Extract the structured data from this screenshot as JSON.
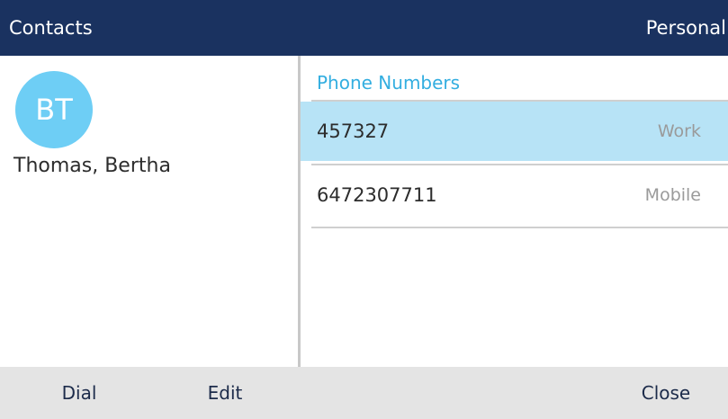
{
  "header": {
    "title": "Contacts",
    "list_name": "Personal"
  },
  "contact": {
    "initials": "BT",
    "name": "Thomas, Bertha"
  },
  "phone_numbers": {
    "section_label": "Phone Numbers",
    "items": [
      {
        "number": "457327",
        "type": "Work",
        "selected": true
      },
      {
        "number": "6472307711",
        "type": "Mobile",
        "selected": false
      }
    ]
  },
  "softkeys": {
    "dial": "Dial",
    "edit": "Edit",
    "close": "Close"
  },
  "colors": {
    "header_bg": "#1a3260",
    "avatar_bg": "#6ecef5",
    "accent": "#33aee0",
    "selected_row": "#b7e3f6",
    "softkey_bar": "#e4e4e4"
  }
}
